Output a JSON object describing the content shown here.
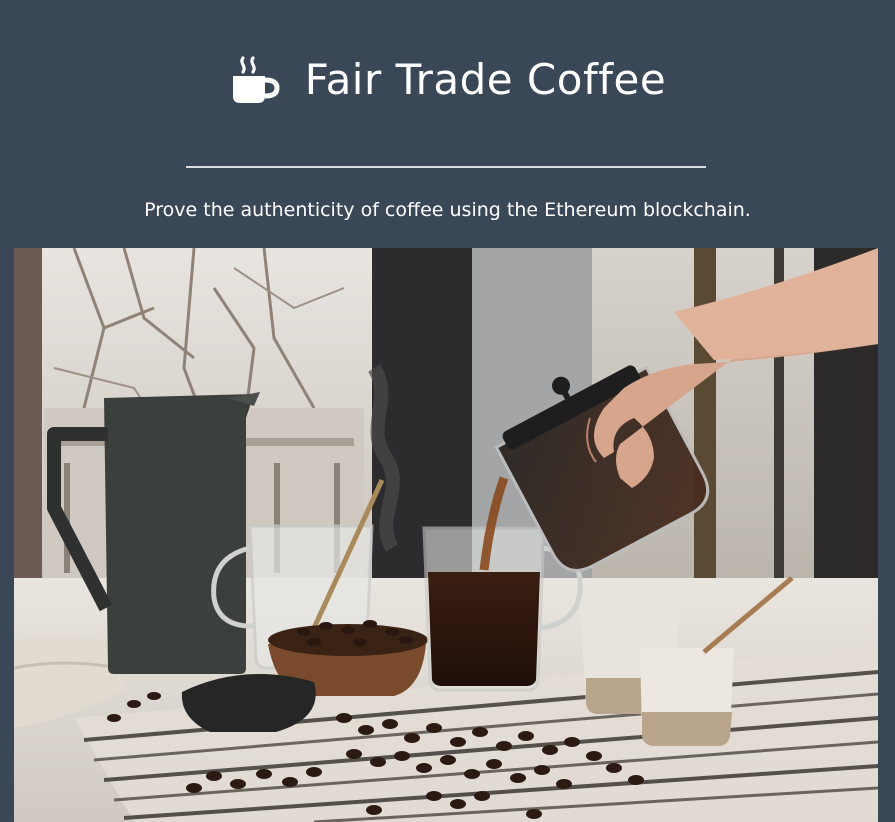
{
  "header": {
    "icon": "coffee-cup-icon",
    "title": "Fair Trade Coffee",
    "subtitle": "Prove the authenticity of coffee using the Ethereum blockchain."
  },
  "hero": {
    "image": "coffee-pouring-photo"
  },
  "colors": {
    "background": "#3a4757",
    "text": "#ffffff",
    "divider": "#d9dde2"
  }
}
